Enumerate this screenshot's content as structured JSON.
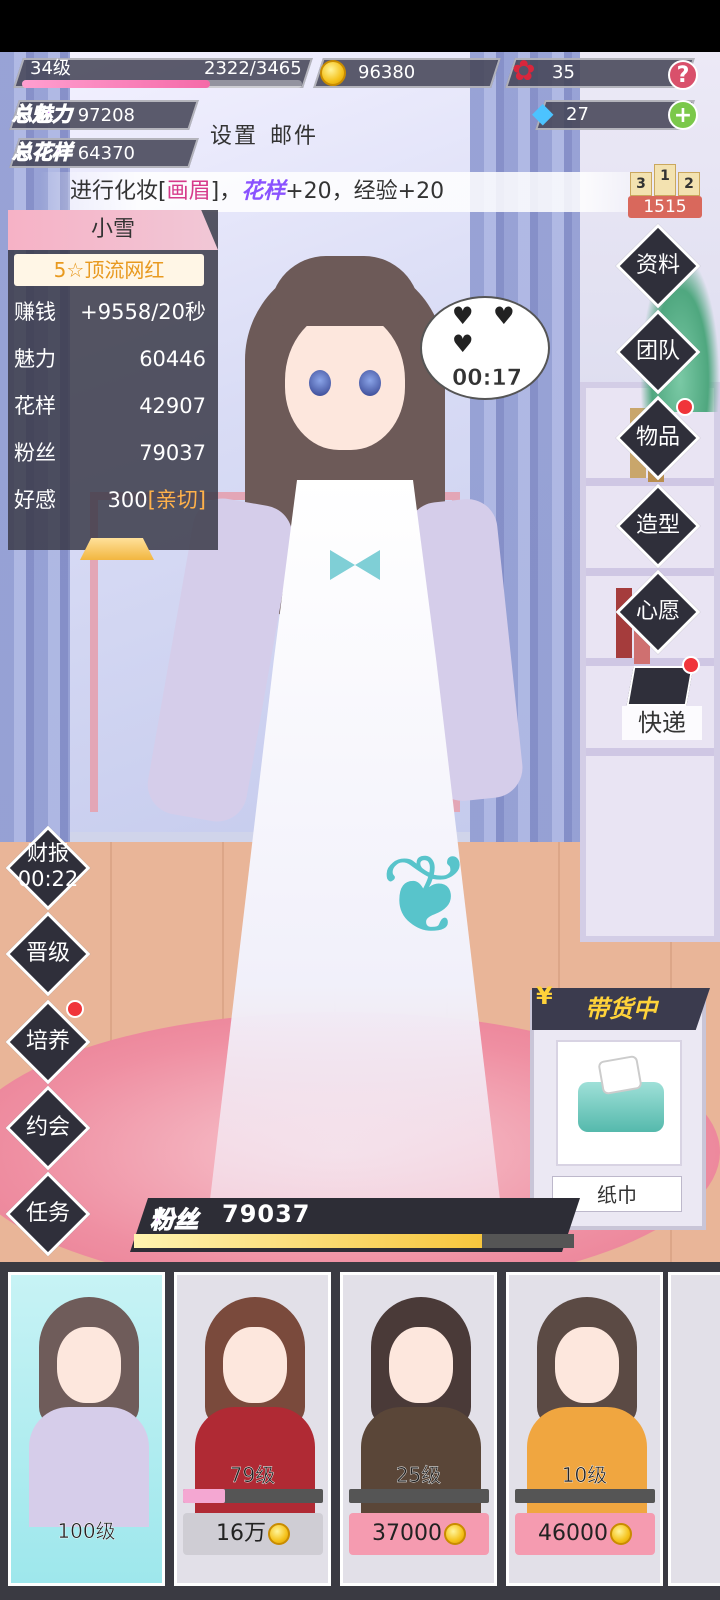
{
  "hud": {
    "level": "34级",
    "exp": "2322/3465",
    "exp_progress": 0.67,
    "coins": "96380",
    "roses": "35",
    "diamonds": "27",
    "help_symbol": "?",
    "add_symbol": "+",
    "total_charm_label": "总魅力",
    "total_charm": "97208",
    "total_style_label": "总花样",
    "total_style": "64370",
    "settings_label": "设置",
    "mail_label": "邮件"
  },
  "ticker": {
    "prefix": "进行化妆[",
    "item": "画眉",
    "mid": "]，",
    "stat": "花样",
    "suffix": "+20，经验+20"
  },
  "rank": {
    "first": "1",
    "second": "2",
    "third": "3",
    "value": "1515"
  },
  "character": {
    "name": "小雪",
    "title": "5☆顶流网红",
    "stats": [
      {
        "label": "赚钱",
        "value": "+9558/20秒"
      },
      {
        "label": "魅力",
        "value": "60446"
      },
      {
        "label": "花样",
        "value": "42907"
      },
      {
        "label": "粉丝",
        "value": "79037"
      },
      {
        "label": "好感",
        "value": "300",
        "tag": "[亲切]"
      }
    ]
  },
  "bubble": {
    "hearts": "♥ ♥ ♥",
    "timer": "00:17"
  },
  "right_menu": [
    "资料",
    "团队",
    "物品",
    "造型",
    "心愿",
    "快递"
  ],
  "left_menu": {
    "report_label": "财报",
    "report_timer": "00:22",
    "items": [
      "晋级",
      "培养",
      "约会",
      "任务"
    ]
  },
  "selling": {
    "banner": "带货中",
    "currency_symbol": "¥",
    "item": "纸巾"
  },
  "fans": {
    "label": "粉丝",
    "value": "79037",
    "progress": 0.79
  },
  "roster": [
    {
      "level": "100级",
      "selected": true,
      "hair": "#6f5c5a",
      "outfit": "#d6cdea"
    },
    {
      "level": "79级",
      "price": "16万",
      "price_style": "grey",
      "progress": 0.3,
      "hair": "#7a4a3c",
      "outfit": "#b02a34"
    },
    {
      "level": "25级",
      "price": "37000",
      "price_style": "pink",
      "progress": 0.0,
      "hair": "#4a3a38",
      "outfit": "#5a4638"
    },
    {
      "level": "10级",
      "price": "46000",
      "price_style": "pink",
      "progress": 0.0,
      "hair": "#5b4a44",
      "outfit": "#f0a640"
    }
  ],
  "colors": {
    "accent_pink": "#f56aa8",
    "panel_bg": "#3a3a48",
    "gold": "#f5c21b",
    "highlight_purple": "#8a52ff"
  },
  "icons": {
    "coin": "coin-icon",
    "rose": "rose-icon",
    "diamond": "diamond-icon",
    "help": "help-icon",
    "add": "plus-icon",
    "delivery": "delivery-box-icon",
    "tissue": "tissue-box-icon"
  }
}
